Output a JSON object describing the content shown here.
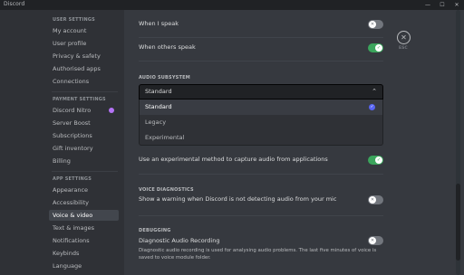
{
  "window": {
    "title": "Discord",
    "controls": {
      "minimize": "—",
      "maximize": "☐",
      "close": "✕"
    }
  },
  "sidebar": {
    "categories": {
      "user_settings": "USER SETTINGS",
      "payment_settings": "PAYMENT SETTINGS",
      "app_settings": "APP SETTINGS"
    },
    "items": {
      "my_account": "My account",
      "user_profile": "User profile",
      "privacy": "Privacy & safety",
      "authorised_apps": "Authorised apps",
      "connections": "Connections",
      "discord_nitro": "Discord Nitro",
      "server_boost": "Server Boost",
      "subscriptions": "Subscriptions",
      "gift_inventory": "Gift inventory",
      "billing": "Billing",
      "appearance": "Appearance",
      "accessibility": "Accessibility",
      "voice_video": "Voice & video",
      "text_images": "Text & images",
      "notifications": "Notifications",
      "keybinds": "Keybinds",
      "language": "Language"
    },
    "active_item": "voice_video"
  },
  "main": {
    "when_i_speak": {
      "label": "When I speak",
      "enabled": false
    },
    "when_others_speak": {
      "label": "When others speak",
      "enabled": true
    },
    "audio_subsystem": {
      "header": "AUDIO SUBSYSTEM",
      "selected": "Standard",
      "options": [
        "Standard",
        "Legacy",
        "Experimental"
      ]
    },
    "experimental_capture": {
      "label": "Use an experimental method to capture audio from applications",
      "enabled": true
    },
    "voice_diagnostics": {
      "header": "VOICE DIAGNOSTICS",
      "warning_label": "Show a warning when Discord is not detecting audio from your mic",
      "enabled": false
    },
    "debugging": {
      "header": "DEBUGGING",
      "diag_label": "Diagnostic Audio Recording",
      "diag_desc": "Diagnostic audio recording is used for analysing audio problems. The last five minutes of voice is saved to voice module folder.",
      "enabled": false
    }
  },
  "close_button": {
    "icon": "✕",
    "label": "ESC"
  },
  "colors": {
    "toggle_on": "#3ba55c",
    "toggle_off": "#72767d",
    "accent": "#5865f2",
    "nitro": "#b473f5"
  }
}
